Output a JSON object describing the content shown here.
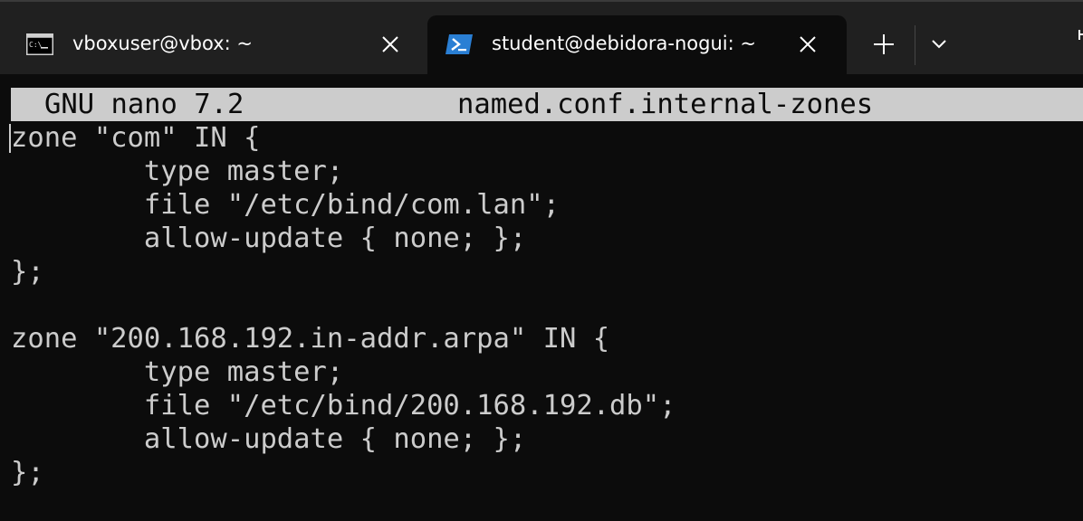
{
  "tabs": [
    {
      "title": "vboxuser@vbox: ~",
      "icon": "command-prompt-icon",
      "active": false
    },
    {
      "title": "student@debidora-nogui: ~",
      "icon": "powershell-icon",
      "active": true
    }
  ],
  "editor": {
    "app_label": "GNU nano 7.2",
    "filename": "named.conf.internal-zones",
    "lines": [
      "zone \"com\" IN {",
      "        type master;",
      "        file \"/etc/bind/com.lan\";",
      "        allow-update { none; };",
      "};",
      "",
      "zone \"200.168.192.in-addr.arpa\" IN {",
      "        type master;",
      "        file \"/etc/bind/200.168.192.db\";",
      "        allow-update { none; };",
      "};"
    ]
  },
  "colors": {
    "tabbar_bg": "#202020",
    "terminal_bg": "#0c0c0c",
    "terminal_fg": "#cccccc",
    "powershell_blue": "#2a7fd4"
  }
}
